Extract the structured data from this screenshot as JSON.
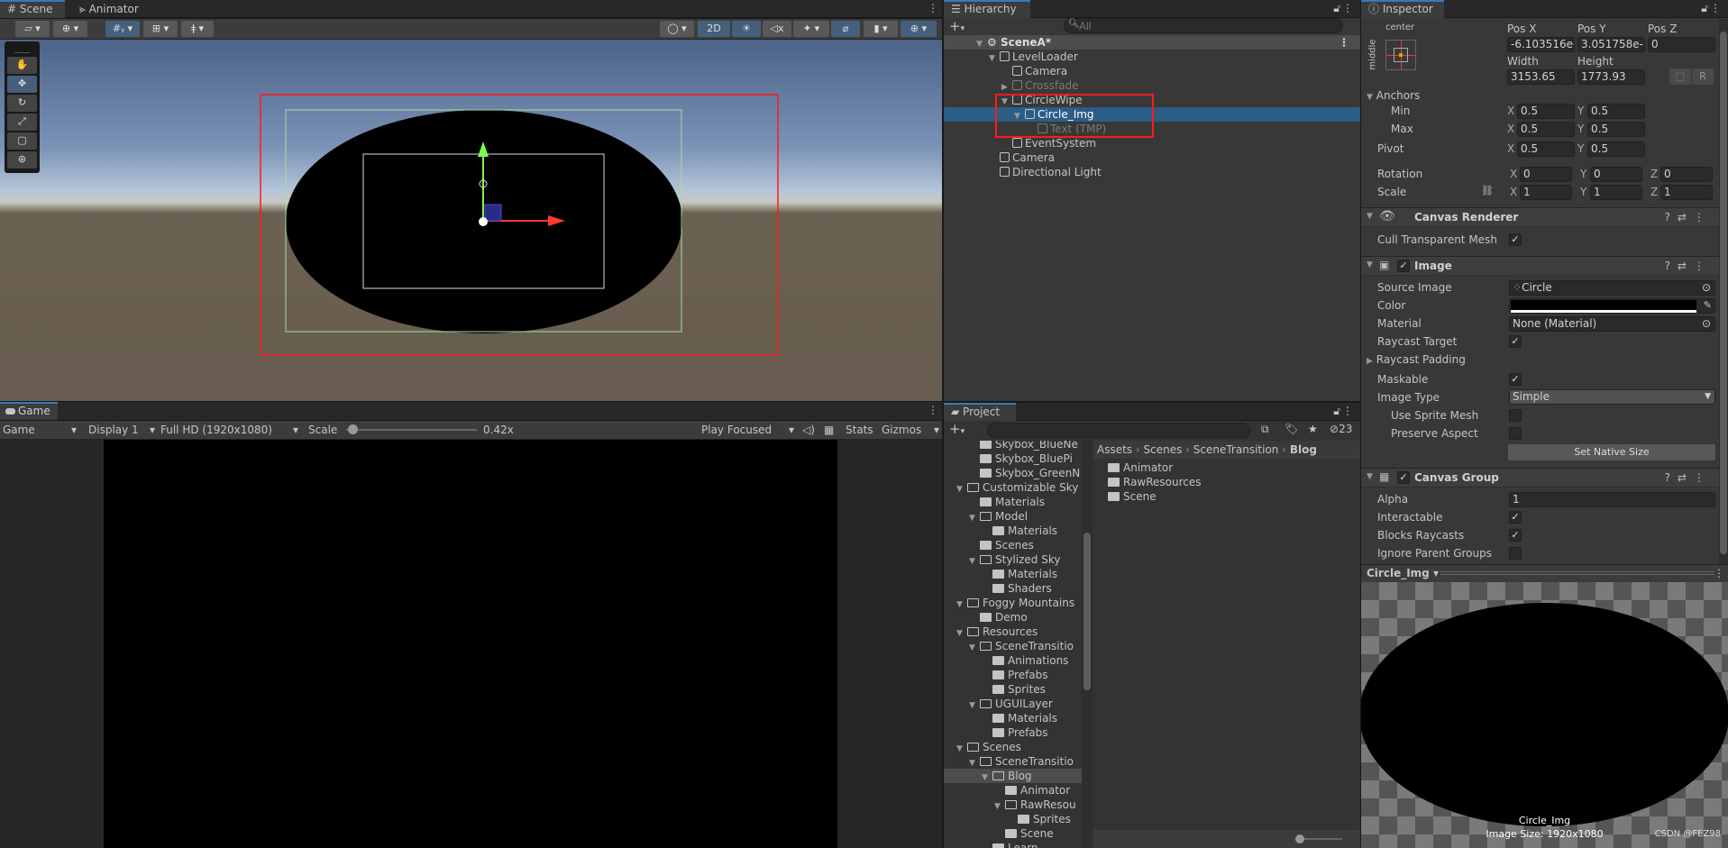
{
  "scene": {
    "tabs": [
      {
        "label": "Scene",
        "icon": "hash-icon"
      },
      {
        "label": "Animator",
        "icon": "animator-icon"
      }
    ],
    "toolbar": {
      "mode_2d": "2D"
    },
    "tools": [
      "hand-icon",
      "move-icon",
      "rotate-icon",
      "scale-icon",
      "rect-icon",
      "transform-icon"
    ]
  },
  "game": {
    "tab": "Game",
    "toolbar": {
      "view": "Game",
      "display": "Display 1",
      "resolution": "Full HD (1920x1080)",
      "scale_label": "Scale",
      "scale_value": "0.42x",
      "scale_fraction": 0.05,
      "play_mode": "Play Focused",
      "stats": "Stats",
      "gizmos": "Gizmos"
    }
  },
  "hierarchy": {
    "tab": "Hierarchy",
    "search_placeholder": "All",
    "scene": "SceneA*",
    "items": [
      {
        "label": "LevelLoader",
        "depth": 1,
        "arrow": "down"
      },
      {
        "label": "Camera",
        "depth": 2,
        "arrow": ""
      },
      {
        "label": "Crossfade",
        "depth": 2,
        "arrow": "right",
        "dim": true
      },
      {
        "label": "CircleWipe",
        "depth": 2,
        "arrow": "down"
      },
      {
        "label": "Circle_Img",
        "depth": 3,
        "arrow": "down",
        "selected": true
      },
      {
        "label": "Text (TMP)",
        "depth": 4,
        "arrow": "",
        "dim": true
      },
      {
        "label": "EventSystem",
        "depth": 2,
        "arrow": ""
      },
      {
        "label": "Camera",
        "depth": 1,
        "arrow": ""
      },
      {
        "label": "Directional Light",
        "depth": 1,
        "arrow": ""
      }
    ]
  },
  "project": {
    "tab": "Project",
    "hidden_count": "23",
    "breadcrumb": [
      "Assets",
      "Scenes",
      "SceneTransition",
      "Blog"
    ],
    "contents": [
      "Animator",
      "RawResources",
      "Scene"
    ],
    "tree": [
      {
        "label": "Skybox_BlueNe",
        "depth": 1
      },
      {
        "label": "Skybox_BluePi",
        "depth": 1
      },
      {
        "label": "Skybox_GreenN",
        "depth": 1
      },
      {
        "label": "Customizable Sky",
        "depth": 0,
        "open": true
      },
      {
        "label": "Materials",
        "depth": 1
      },
      {
        "label": "Model",
        "depth": 1,
        "open": true
      },
      {
        "label": "Materials",
        "depth": 2
      },
      {
        "label": "Scenes",
        "depth": 1
      },
      {
        "label": "Stylized Sky",
        "depth": 1,
        "open": true
      },
      {
        "label": "Materials",
        "depth": 2
      },
      {
        "label": "Shaders",
        "depth": 2
      },
      {
        "label": "Foggy Mountains",
        "depth": 0,
        "open": true
      },
      {
        "label": "Demo",
        "depth": 1
      },
      {
        "label": "Resources",
        "depth": 0,
        "open": true
      },
      {
        "label": "SceneTransitio",
        "depth": 1,
        "open": true
      },
      {
        "label": "Animations",
        "depth": 2
      },
      {
        "label": "Prefabs",
        "depth": 2
      },
      {
        "label": "Sprites",
        "depth": 2
      },
      {
        "label": "UGUILayer",
        "depth": 1,
        "open": true
      },
      {
        "label": "Materials",
        "depth": 2
      },
      {
        "label": "Prefabs",
        "depth": 2
      },
      {
        "label": "Scenes",
        "depth": 0,
        "open": true
      },
      {
        "label": "SceneTransitio",
        "depth": 1,
        "open": true
      },
      {
        "label": "Blog",
        "depth": 2,
        "open": true,
        "selected": true
      },
      {
        "label": "Animator",
        "depth": 3
      },
      {
        "label": "RawResou",
        "depth": 3,
        "open": true
      },
      {
        "label": "Sprites",
        "depth": 4
      },
      {
        "label": "Scene",
        "depth": 3
      },
      {
        "label": "Learn",
        "depth": 2
      }
    ]
  },
  "inspector": {
    "tab": "Inspector",
    "rect": {
      "anchor_h": "center",
      "anchor_v": "middle",
      "pos_x_label": "Pos X",
      "pos_y_label": "Pos Y",
      "pos_z_label": "Pos Z",
      "pos_x": "-6.103516e-",
      "pos_y": "3.051758e-(",
      "pos_z": "0",
      "width_label": "Width",
      "height_label": "Height",
      "width": "3153.65",
      "height": "1773.93",
      "r_button": "R",
      "anchors_label": "Anchors",
      "min_label": "Min",
      "max_label": "Max",
      "pivot_label": "Pivot",
      "min_x": "0.5",
      "min_y": "0.5",
      "max_x": "0.5",
      "max_y": "0.5",
      "pivot_x": "0.5",
      "pivot_y": "0.5",
      "rotation_label": "Rotation",
      "scale_label": "Scale",
      "rot_x": "0",
      "rot_y": "0",
      "rot_z": "0",
      "scale_x": "1",
      "scale_y": "1",
      "scale_z": "1",
      "x": "X",
      "y": "Y",
      "z": "Z"
    },
    "canvas_renderer": {
      "title": "Canvas Renderer",
      "cull_label": "Cull Transparent Mesh",
      "cull": true
    },
    "image": {
      "title": "Image",
      "enabled": true,
      "source_label": "Source Image",
      "source": "Circle",
      "color_label": "Color",
      "color": "#000000",
      "material_label": "Material",
      "material": "None (Material)",
      "raycast_label": "Raycast Target",
      "raycast": true,
      "padding_label": "Raycast Padding",
      "maskable_label": "Maskable",
      "maskable": true,
      "type_label": "Image Type",
      "type": "Simple",
      "sprite_mesh_label": "Use Sprite Mesh",
      "sprite_mesh": false,
      "preserve_label": "Preserve Aspect",
      "preserve": false,
      "native_button": "Set Native Size"
    },
    "canvas_group": {
      "title": "Canvas Group",
      "enabled": true,
      "alpha_label": "Alpha",
      "alpha": "1",
      "interactable_label": "Interactable",
      "interactable": true,
      "blocks_label": "Blocks Raycasts",
      "blocks": true,
      "ignore_label": "Ignore Parent Groups",
      "ignore": false
    },
    "preview": {
      "object": "Circle_Img",
      "name": "Circle_Img",
      "size": "Image Size: 1920x1080",
      "watermark": "CSDN @FEZ98"
    }
  },
  "colors": {
    "selection": "#2c5d87",
    "accent": "#3a79bb",
    "highlight_box": "#ff1a1a"
  }
}
